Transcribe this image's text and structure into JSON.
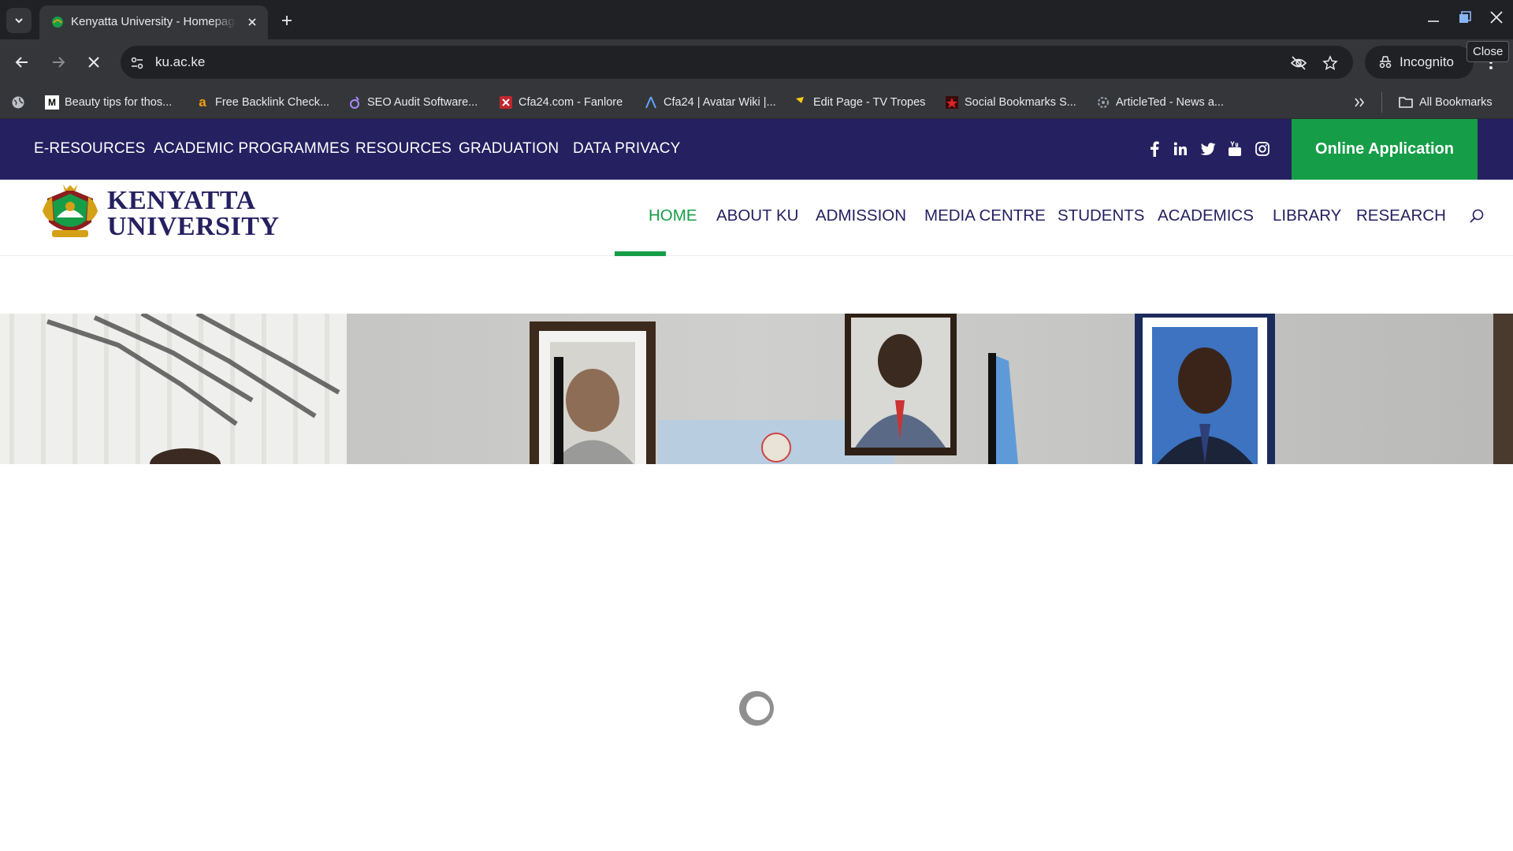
{
  "browser": {
    "tab_title": "Kenyatta University - Homepage",
    "tooltip": "Close",
    "url": "ku.ac.ke",
    "incognito_label": "Incognito",
    "bookmarks": [
      {
        "label": "Beauty tips for thos...",
        "icon": "M"
      },
      {
        "label": "Free Backlink Check...",
        "icon": "a"
      },
      {
        "label": "SEO Audit Software...",
        "icon": "seo-icon"
      },
      {
        "label": "Cfa24.com - Fanlore",
        "icon": "fanlore-icon"
      },
      {
        "label": "Cfa24 | Avatar Wiki |...",
        "icon": "avatar-wiki-icon"
      },
      {
        "label": "Edit Page - TV Tropes",
        "icon": "tvtropes-icon"
      },
      {
        "label": "Social Bookmarks S...",
        "icon": "star-icon"
      },
      {
        "label": "ArticleTed - News a...",
        "icon": "articleted-icon"
      }
    ],
    "all_bookmarks": "All Bookmarks"
  },
  "site": {
    "top_links": [
      "E-RESOURCES",
      "ACADEMIC PROGRAMMES",
      "RESOURCES",
      "GRADUATION",
      "DATA PRIVACY"
    ],
    "apply_label": "Online Application",
    "logo_line1": "KENYATTA",
    "logo_line2": "UNIVERSITY",
    "nav": [
      "HOME",
      "ABOUT KU",
      "ADMISSION",
      "MEDIA CENTRE",
      "STUDENTS",
      "ACADEMICS",
      "LIBRARY",
      "RESEARCH"
    ],
    "active_nav": "HOME",
    "colors": {
      "navy": "#252060",
      "green": "#169d48"
    }
  }
}
